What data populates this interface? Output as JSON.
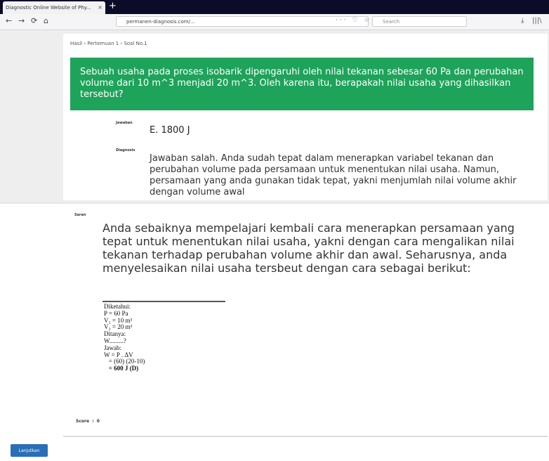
{
  "browser": {
    "tab_title": "Diagnostic Online Website of Phy...",
    "tab_close": "×",
    "new_tab": "+",
    "back": "←",
    "forward": "→",
    "reload": "⟳",
    "home": "⌂",
    "url": "permanen-diagnosis.com/...",
    "url_icons": "··· ♡ ☆",
    "search_placeholder": "Search",
    "downloads": "⤓",
    "library": "|||\\"
  },
  "breadcrumb": "Hasil › Pertemuan 1 › Soal No.1",
  "question": "Sebuah usaha pada proses isobarik dipengaruhi oleh nilai tekanan sebesar 60 Pa dan perubahan volume dari 10 m^3 menjadi 20 m^3. Oleh karena itu, berapakah nilai usaha yang dihasilkan tersebut?",
  "answer_label": "Jawaban",
  "answer_value": "E. 1800 J",
  "diagnosis_label": "Diagnosis",
  "diagnosis_text": "Jawaban salah. Anda sudah tepat dalam menerapkan variabel tekanan dan perubahan volume pada persamaan untuk menentukan nilai usaha. Namun, persamaan yang anda gunakan tidak tepat, yakni menjumlah nilai volume akhir dengan volume awal",
  "saran_label": "Saran",
  "saran_text": "Anda sebaiknya mempelajari kembali cara menerapkan persamaan yang tepat untuk menentukan nilai usaha, yakni dengan cara mengalikan nilai tekanan terhadap perubahan volume akhir dan awal. Seharusnya, anda menyelesaikan nilai usaha tersbeut dengan cara sebagai berikut:",
  "work": {
    "l1": "Diketahui:",
    "l2": "P = 60 Pa",
    "l3": "V₁ = 10 m³",
    "l4": "V₂ = 20 m³",
    "l5": "Ditanya:",
    "l6": "W.........?",
    "l7": "Jawab:",
    "l8": "W = P . ΔV",
    "l9": "   = (60) (20-10)",
    "l10": "   = 600 J (D)"
  },
  "skor_label": "Score",
  "skor_value": "0",
  "button_label": "Lanjutkan"
}
